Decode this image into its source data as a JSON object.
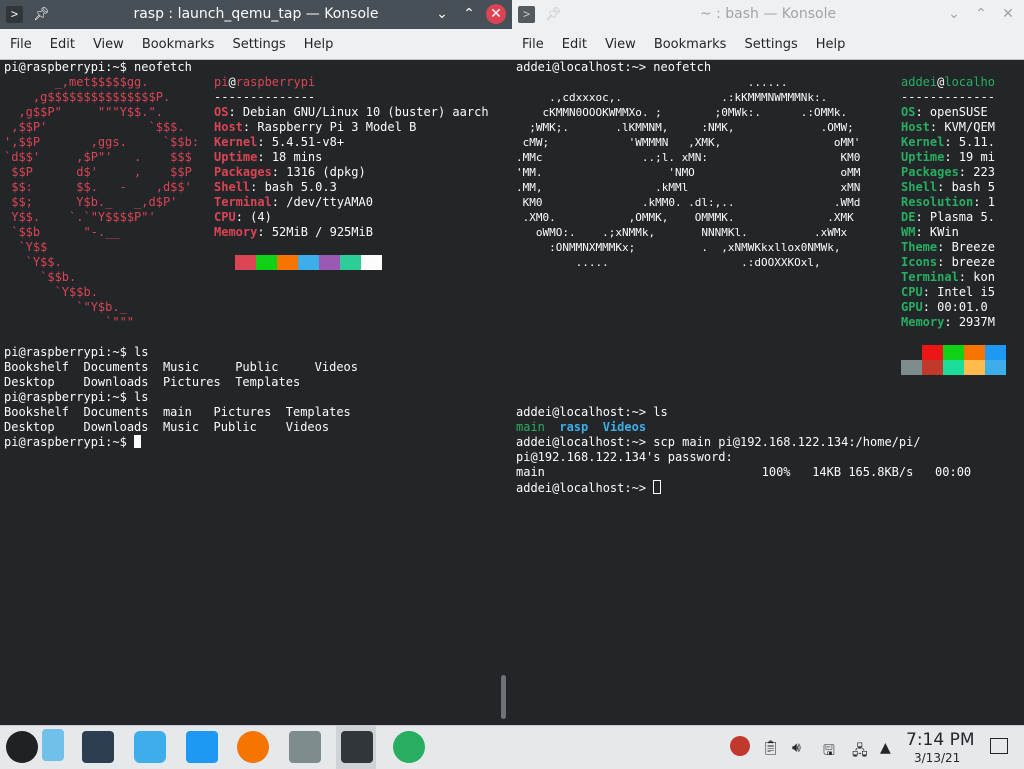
{
  "left": {
    "title": "rasp : launch_qemu_tap — Konsole",
    "menu": [
      "File",
      "Edit",
      "View",
      "Bookmarks",
      "Settings",
      "Help"
    ],
    "prompt_cmd": "pi@raspberrypi:~$ neofetch",
    "logo": "       _,met$$$$$gg.\n    ,g$$$$$$$$$$$$$$$P.\n  ,g$$P\"     \"\"\"Y$$.\".\n ,$$P'              `$$$.\n',$$P       ,ggs.     `$$b:\n`d$$'     ,$P\"'   .    $$$\n $$P      d$'     ,    $$P\n $$:      $$.   -    ,d$$'\n $$;      Y$b._   _,d$P'\n Y$$.    `.`\"Y$$$$P\"'\n `$$b      \"-.__\n  `Y$$\n   `Y$$.\n     `$$b.\n       `Y$$b.\n          `\"Y$b._\n              `\"\"\"",
    "user": "pi",
    "at": "@",
    "host": "raspberrypi",
    "sep": "--------------",
    "info": [
      {
        "k": "OS",
        "v": "Debian GNU/Linux 10 (buster) aarch"
      },
      {
        "k": "Host",
        "v": "Raspberry Pi 3 Model B"
      },
      {
        "k": "Kernel",
        "v": "5.4.51-v8+"
      },
      {
        "k": "Uptime",
        "v": "18 mins"
      },
      {
        "k": "Packages",
        "v": "1316 (dpkg)"
      },
      {
        "k": "Shell",
        "v": "bash 5.0.3"
      },
      {
        "k": "Terminal",
        "v": "/dev/ttyAMA0"
      },
      {
        "k": "CPU",
        "v": "(4)"
      },
      {
        "k": "Memory",
        "v": "52MiB / 925MiB"
      }
    ],
    "colon": ": ",
    "swatches": [
      "#232629",
      "#da4453",
      "#11d116",
      "#f67400",
      "#3daee9",
      "#9b59b6",
      "#2ecc97",
      "#fcfcfc"
    ],
    "after": [
      "pi@raspberrypi:~$ ls",
      "Bookshelf  Documents  Music     Public     Videos",
      "Desktop    Downloads  Pictures  Templates",
      "pi@raspberrypi:~$ ls",
      "Bookshelf  Documents  main   Pictures  Templates",
      "Desktop    Downloads  Music  Public    Videos"
    ],
    "final_prompt": "pi@raspberrypi:~$ "
  },
  "right": {
    "title": "~ : bash — Konsole",
    "menu": [
      "File",
      "Edit",
      "View",
      "Bookmarks",
      "Settings",
      "Help"
    ],
    "prompt_cmd": "addei@localhost:~> neofetch",
    "logo": "                                   ......\n     .,cdxxxoc,.               .:kKMMMNWMMMNk:.\n    cKMMN0OOOKWMMXo. ;        ;0MWk:.      .:OMMk.\n  ;WMK;.       .lKMMNM,     :NMK,             .OMW;\n cMW;            'WMMMN   ,XMK,                 oMM'\n.MMc               ..;l. xMN:                    KM0\n'MM.                   'NMO                      oMM\n.MM,                 .kMMl                       xMN\n KM0               .kMM0. .dl:,..               .WMd\n .XM0.           ,OMMK,    OMMMK.              .XMK\n   oWMO:.    .;xNMMk,       NNNMKl.          .xWMx\n     :ONMMNXMMMKx;          .  ,xNMWKkxllox0NMWk,\n         .....                    .:dOOXXKOxl,",
    "user": "addei",
    "at": "@",
    "host": "localho",
    "sep": "-------------",
    "info": [
      {
        "k": "OS",
        "v": "openSUSE"
      },
      {
        "k": "Host",
        "v": "KVM/QEM"
      },
      {
        "k": "Kernel",
        "v": "5.11."
      },
      {
        "k": "Uptime",
        "v": "19 mi"
      },
      {
        "k": "Packages",
        "v": "223"
      },
      {
        "k": "Shell",
        "v": "bash 5"
      },
      {
        "k": "Resolution",
        "v": "1"
      },
      {
        "k": "DE",
        "v": "Plasma 5."
      },
      {
        "k": "WM",
        "v": "KWin"
      },
      {
        "k": "Theme",
        "v": "Breeze"
      },
      {
        "k": "Icons",
        "v": "breeze"
      },
      {
        "k": "Terminal",
        "v": "kon"
      },
      {
        "k": "CPU",
        "v": "Intel i5"
      },
      {
        "k": "GPU",
        "v": "00:01.0"
      },
      {
        "k": "Memory",
        "v": "2937M"
      }
    ],
    "colon": ": ",
    "swatches_top": [
      "#232629",
      "#ed1515",
      "#11d116",
      "#f67400",
      "#1d99f3"
    ],
    "swatches_bottom": [
      "#7f8c8d",
      "#c0392b",
      "#1cdc9a",
      "#fdbc4b",
      "#3daee9"
    ],
    "ls_prompt": "addei@localhost:~> ls",
    "ls_items": [
      "main",
      "rasp",
      "Videos"
    ],
    "scp_cmd": "addei@localhost:~> scp main pi@192.168.122.134:/home/pi/",
    "pw": "pi@192.168.122.134's password:",
    "xfer": "main                              100%   14KB 165.8KB/s   00:00",
    "final_prompt": "addei@localhost:~> "
  },
  "taskbar": {
    "time": "7:14 PM",
    "date": "3/13/21"
  }
}
